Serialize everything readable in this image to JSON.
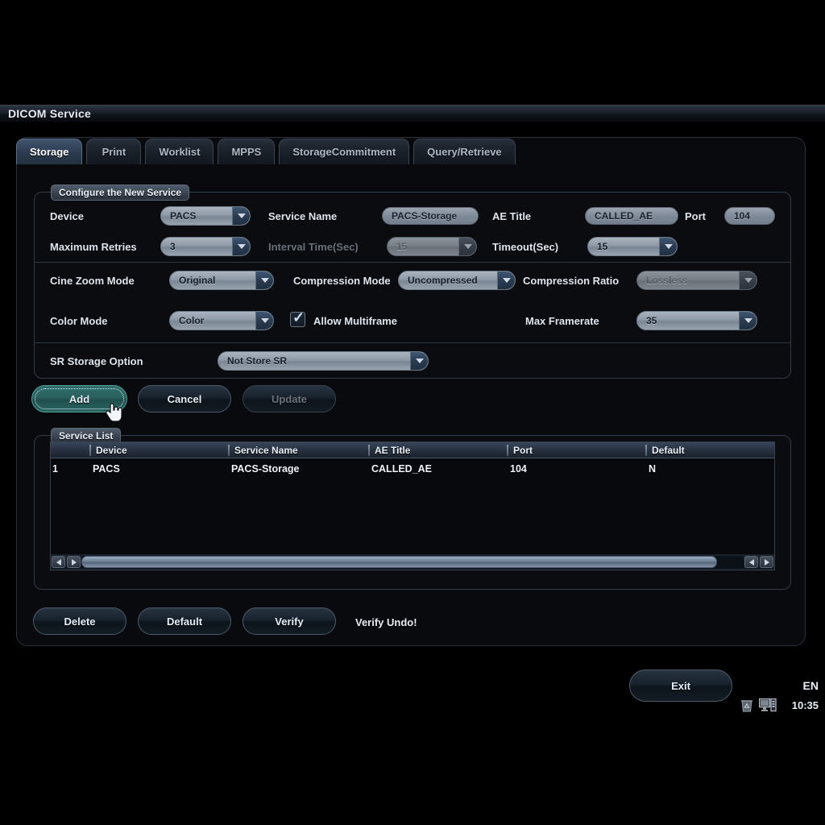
{
  "titlebar": {
    "title": "DICOM Service"
  },
  "tabs": [
    {
      "label": "Storage",
      "active": true
    },
    {
      "label": "Print",
      "active": false
    },
    {
      "label": "Worklist",
      "active": false
    },
    {
      "label": "MPPS",
      "active": false
    },
    {
      "label": "StorageCommitment",
      "active": false
    },
    {
      "label": "Query/Retrieve",
      "active": false
    }
  ],
  "config": {
    "group_title": "Configure the New Service",
    "device_label": "Device",
    "device_value": "PACS",
    "service_name_label": "Service Name",
    "service_name_value": "PACS-Storage",
    "ae_title_label": "AE Title",
    "ae_title_value": "CALLED_AE",
    "port_label": "Port",
    "port_value": "104",
    "max_retries_label": "Maximum Retries",
    "max_retries_value": "3",
    "interval_time_label": "Interval Time(Sec)",
    "interval_time_value": "15",
    "timeout_label": "Timeout(Sec)",
    "timeout_value": "15",
    "cine_zoom_label": "Cine Zoom Mode",
    "cine_zoom_value": "Original",
    "compression_mode_label": "Compression Mode",
    "compression_mode_value": "Uncompressed",
    "compression_ratio_label": "Compression Ratio",
    "compression_ratio_value": "Lossless",
    "color_mode_label": "Color Mode",
    "color_mode_value": "Color",
    "allow_multiframe_label": "Allow Multiframe",
    "allow_multiframe_checked": true,
    "max_framerate_label": "Max Framerate",
    "max_framerate_value": "35",
    "sr_storage_label": "SR Storage Option",
    "sr_storage_value": "Not Store SR"
  },
  "actions": {
    "add_label": "Add",
    "cancel_label": "Cancel",
    "update_label": "Update"
  },
  "service_list": {
    "group_title": "Service List",
    "columns": [
      "",
      "Device",
      "Service Name",
      "AE Title",
      "Port",
      "Default"
    ],
    "rows": [
      {
        "index": "1",
        "device": "PACS",
        "service_name": "PACS-Storage",
        "ae_title": "CALLED_AE",
        "port": "104",
        "default": "N"
      }
    ]
  },
  "bottom_actions": {
    "delete_label": "Delete",
    "default_label": "Default",
    "verify_label": "Verify",
    "verify_status": "Verify Undo!"
  },
  "footer": {
    "exit_label": "Exit",
    "language": "EN",
    "time": "10:35",
    "tray_icons": [
      "recycle-bin-icon",
      "computer-icon"
    ]
  },
  "colors": {
    "accent": "#2f6f6c",
    "tab_active": "#41546f",
    "panel_bg": "#080a0d",
    "text": "#e6edf5"
  }
}
